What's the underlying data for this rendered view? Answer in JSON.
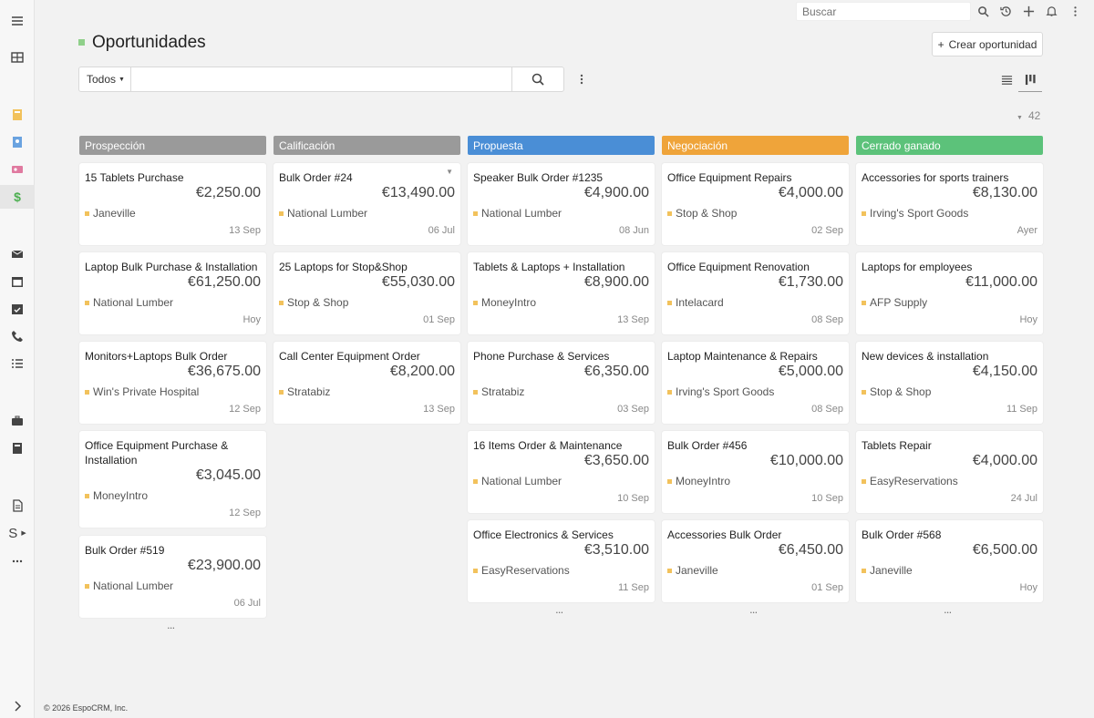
{
  "app": {
    "search_placeholder": "Buscar",
    "footer": "© 2026 EspoCRM, Inc."
  },
  "nav": {
    "icons": [
      "menu-icon",
      "grid-icon",
      "bookmark-icon",
      "contact-book-icon",
      "id-card-icon",
      "dollar-icon",
      "mail-icon",
      "calendar-icon",
      "calendar-check-icon",
      "phone-icon",
      "tasks-icon",
      "briefcase-icon",
      "book-icon",
      "document-icon",
      "s-icon",
      "more-icon",
      "expand-icon"
    ],
    "s_label": "S",
    "dollar_label": "$"
  },
  "header": {
    "title": "Oportunidades",
    "create_label": "Crear oportunidad",
    "filter_label": "Todos",
    "total_count": "42"
  },
  "colors": {
    "prospeccion": "#9a9a9a",
    "calificacion": "#9a9a9a",
    "propuesta": "#4a8ed6",
    "negociacion": "#efa43a",
    "cerrado": "#5cc27a"
  },
  "columns": [
    {
      "label": "Prospección",
      "cards": [
        {
          "name": "15 Tablets Purchase",
          "amount": "€2,250.00",
          "account": "Janeville",
          "date": "13 Sep"
        },
        {
          "name": "Laptop Bulk Purchase & Installation",
          "amount": "€61,250.00",
          "account": "National Lumber",
          "date": "Hoy"
        },
        {
          "name": "Monitors+Laptops Bulk Order",
          "amount": "€36,675.00",
          "account": "Win's Private Hospital",
          "date": "12 Sep"
        },
        {
          "name": "Office Equipment Purchase & Installation",
          "amount": "€3,045.00",
          "account": "MoneyIntro",
          "date": "12 Sep"
        },
        {
          "name": "Bulk Order #519",
          "amount": "€23,900.00",
          "account": "National Lumber",
          "date": "06 Jul"
        }
      ]
    },
    {
      "label": "Calificación",
      "cards": [
        {
          "name": "Bulk Order #24",
          "amount": "€13,490.00",
          "account": "National Lumber",
          "date": "06 Jul"
        },
        {
          "name": "25 Laptops for Stop&Shop",
          "amount": "€55,030.00",
          "account": "Stop & Shop",
          "date": "01 Sep"
        },
        {
          "name": "Call Center Equipment Order",
          "amount": "€8,200.00",
          "account": "Stratabiz",
          "date": "13 Sep"
        }
      ]
    },
    {
      "label": "Propuesta",
      "cards": [
        {
          "name": "Speaker Bulk Order #1235",
          "amount": "€4,900.00",
          "account": "National Lumber",
          "date": "08 Jun"
        },
        {
          "name": "Tablets & Laptops + Installation",
          "amount": "€8,900.00",
          "account": "MoneyIntro",
          "date": "13 Sep"
        },
        {
          "name": "Phone Purchase & Services",
          "amount": "€6,350.00",
          "account": "Stratabiz",
          "date": "03 Sep"
        },
        {
          "name": "16 Items Order & Maintenance",
          "amount": "€3,650.00",
          "account": "National Lumber",
          "date": "10 Sep"
        },
        {
          "name": "Office Electronics & Services",
          "amount": "€3,510.00",
          "account": "EasyReservations",
          "date": "11 Sep"
        }
      ]
    },
    {
      "label": "Negociación",
      "cards": [
        {
          "name": "Office Equipment Repairs",
          "amount": "€4,000.00",
          "account": "Stop & Shop",
          "date": "02 Sep"
        },
        {
          "name": "Office Equipment Renovation",
          "amount": "€1,730.00",
          "account": "Intelacard",
          "date": "08 Sep"
        },
        {
          "name": "Laptop Maintenance & Repairs",
          "amount": "€5,000.00",
          "account": "Irving's Sport Goods",
          "date": "08 Sep"
        },
        {
          "name": "Bulk Order #456",
          "amount": "€10,000.00",
          "account": "MoneyIntro",
          "date": "10 Sep"
        },
        {
          "name": "Accessories Bulk Order",
          "amount": "€6,450.00",
          "account": "Janeville",
          "date": "01 Sep"
        }
      ]
    },
    {
      "label": "Cerrado ganado",
      "cards": [
        {
          "name": "Accessories for sports trainers",
          "amount": "€8,130.00",
          "account": "Irving's Sport Goods",
          "date": "Ayer"
        },
        {
          "name": "Laptops for employees",
          "amount": "€11,000.00",
          "account": "AFP Supply",
          "date": "Hoy"
        },
        {
          "name": "New devices & installation",
          "amount": "€4,150.00",
          "account": "Stop & Shop",
          "date": "11 Sep"
        },
        {
          "name": "Tablets Repair",
          "amount": "€4,000.00",
          "account": "EasyReservations",
          "date": "24 Jul"
        },
        {
          "name": "Bulk Order #568",
          "amount": "€6,500.00",
          "account": "Janeville",
          "date": "Hoy"
        }
      ]
    }
  ]
}
